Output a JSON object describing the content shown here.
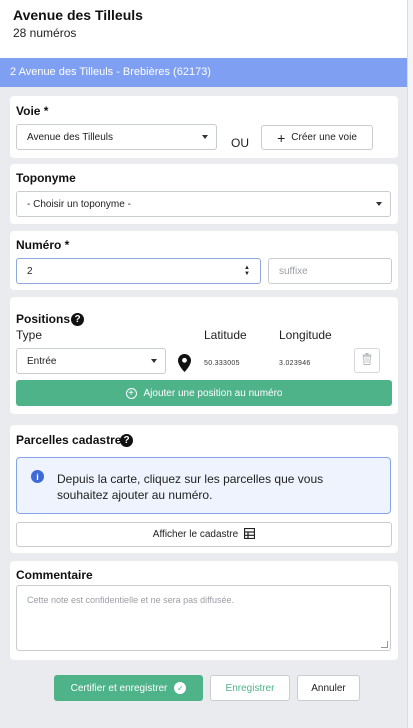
{
  "header": {
    "title": "Avenue des Tilleuls",
    "subtitle": "28 numéros"
  },
  "banner": {
    "text": "2 Avenue des Tilleuls - Brebières (62173)",
    "color": "#7e9ff2"
  },
  "voie": {
    "label": "Voie *",
    "selected": "Avenue des Tilleuls",
    "or_text": "OU",
    "create_label": "Créer une voie"
  },
  "toponyme": {
    "label": "Toponyme",
    "selected": "- Choisir un toponyme -"
  },
  "numero": {
    "label": "Numéro *",
    "value": "2",
    "suffix_placeholder": "suffixe"
  },
  "positions": {
    "label": "Positions",
    "col_type": "Type",
    "col_latitude": "Latitude",
    "col_longitude": "Longitude",
    "type_selected": "Entrée",
    "latitude": "50.333005",
    "longitude": "3.023946",
    "add_label": "Ajouter une position au numéro"
  },
  "parcelles": {
    "label": "Parcelles cadastre",
    "info_text": "Depuis la carte, cliquez sur les parcelles que vous souhaitez ajouter au numéro.",
    "show_label": "Afficher le cadastre"
  },
  "commentaire": {
    "label": "Commentaire",
    "placeholder": "Cette note est confidentielle et ne sera pas diffusée."
  },
  "footer": {
    "certify_label": "Certifier et enregistrer",
    "save_label": "Enregistrer",
    "cancel_label": "Annuler"
  },
  "colors": {
    "accent_green": "#4fb38a",
    "info_blue": "#3f69d6"
  },
  "icons": {
    "help": "question-circle-icon",
    "pin": "map-marker-icon",
    "trash": "trash-icon",
    "plus": "plus-icon",
    "plus_circle": "plus-circle-icon",
    "info": "info-circle-icon",
    "grid": "grid-icon",
    "check": "check-circle-icon",
    "stepper": "stepper-arrows-icon",
    "caret": "chevron-down-icon"
  }
}
